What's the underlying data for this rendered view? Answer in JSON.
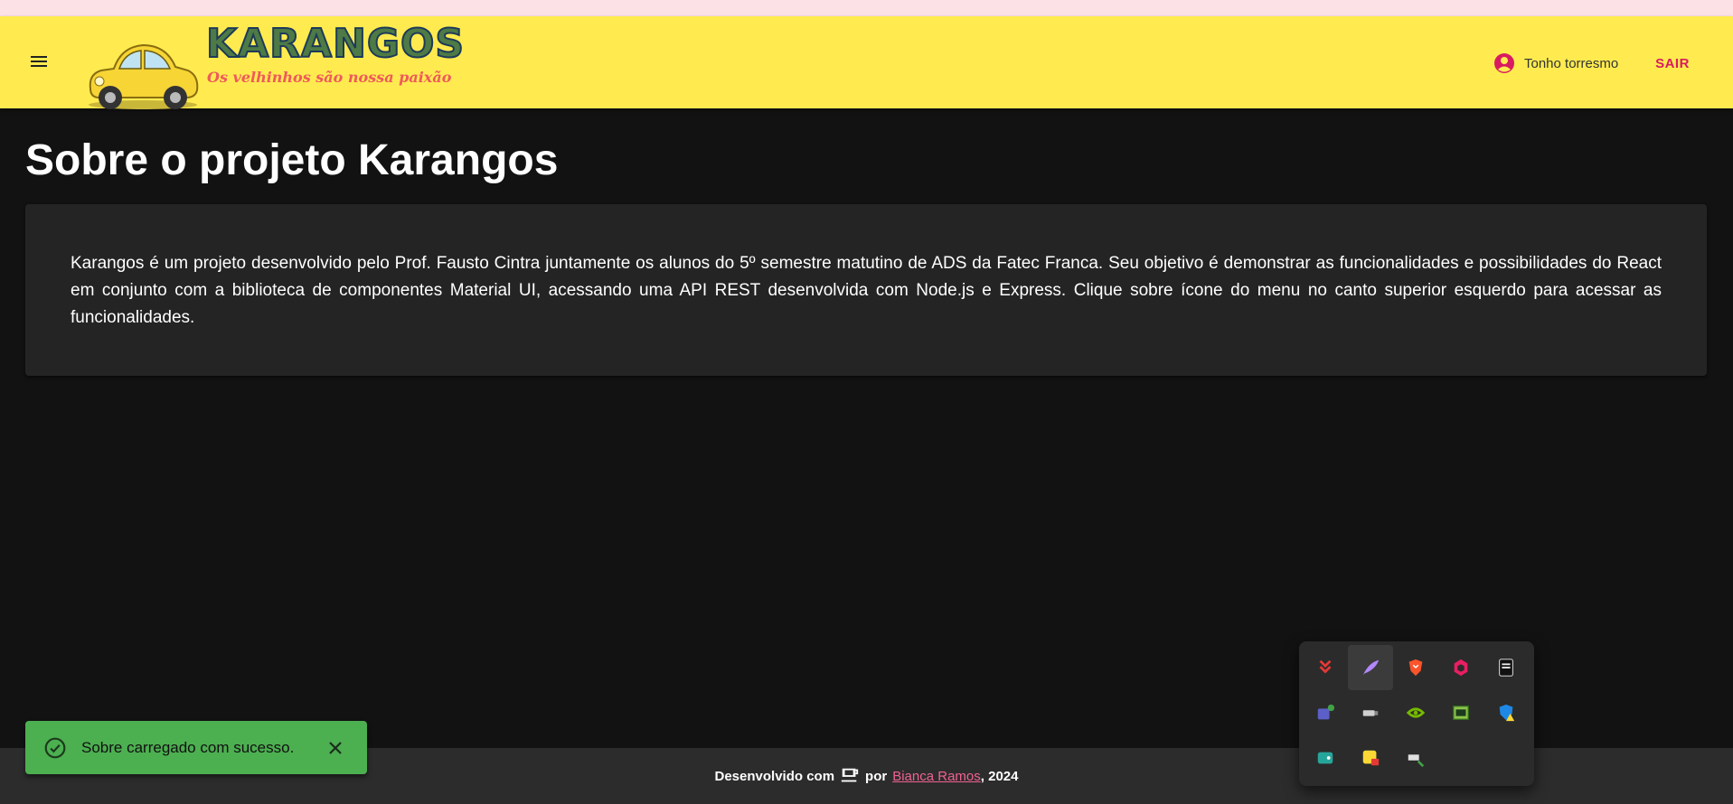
{
  "header": {
    "logo_title": "KARANGOS",
    "logo_subtitle": "Os velhinhos são nossa paixão",
    "user_name": "Tonho torresmo",
    "logout_label": "SAIR"
  },
  "main": {
    "title": "Sobre o projeto Karangos",
    "description": "Karangos é um projeto desenvolvido pelo Prof. Fausto Cintra juntamente os alunos do 5º semestre matutino de ADS da Fatec Franca. Seu objetivo é demonstrar as funcionalidades e possibilidades do React em conjunto com a biblioteca de componentes Material UI, acessando uma API REST desenvolvida com Node.js e Express. Clique sobre ícone do menu no canto superior esquerdo para acessar as funcionalidades."
  },
  "snackbar": {
    "message": "Sobre carregado com sucesso."
  },
  "footer": {
    "prefix": "Desenvolvido com",
    "middle": "por",
    "author": "Bianca Ramos",
    "suffix": ", 2024"
  },
  "tray": {
    "icons": [
      "download-arrow-icon",
      "feather-icon",
      "brave-shield-icon",
      "pink-cube-icon",
      "epic-games-icon",
      "teams-icon",
      "usb-drive-icon",
      "nvidia-icon",
      "memory-chip-icon",
      "defender-warning-icon",
      "wallet-icon",
      "vpn-lock-icon",
      "safely-remove-icon"
    ],
    "active_index": 1
  },
  "colors": {
    "appbar": "#ffeb4f",
    "accent": "#d81b60",
    "success": "#4caf50",
    "background": "#121212",
    "card": "#242424"
  }
}
